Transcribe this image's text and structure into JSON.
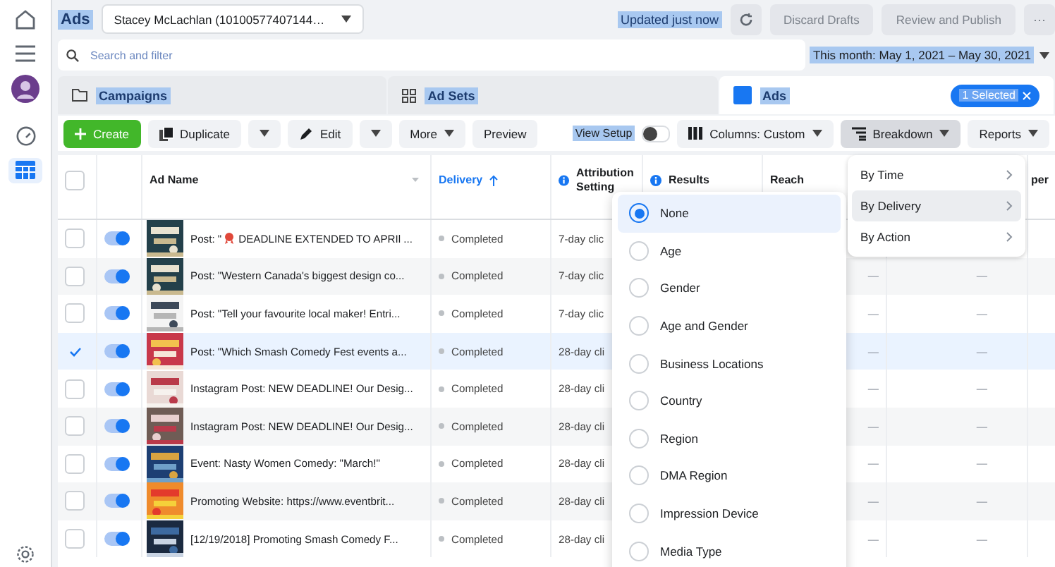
{
  "sidebar": {
    "items": [
      {
        "kind": "home",
        "selected": false
      },
      {
        "kind": "menu",
        "selected": false
      },
      {
        "kind": "avatar",
        "selected": false
      },
      {
        "kind": "gauge",
        "selected": false
      },
      {
        "kind": "table",
        "selected": true
      },
      {
        "kind": "gear",
        "selected": false
      }
    ]
  },
  "top_bar": {
    "title": "Ads",
    "account": "Stacey McLachlan (10100577407144…",
    "status": "Updated just now",
    "buttons": [
      {
        "label": "Discard Drafts",
        "disabled": true
      },
      {
        "label": "Review and Publish",
        "disabled": true
      }
    ],
    "more": "···"
  },
  "search": {
    "placeholder": "Search and filter"
  },
  "date_range": "This month: May 1, 2021 – May 30, 2021",
  "tabs": [
    {
      "kind": "campaigns",
      "label": "Campaigns",
      "selected": false
    },
    {
      "kind": "adsets",
      "label": "Ad Sets",
      "selected": false
    },
    {
      "kind": "ads",
      "label": "Ads",
      "selected": true,
      "badge": "1 Selected"
    }
  ],
  "toolbar": {
    "buttons": [
      {
        "kind": "create",
        "label": "Create"
      },
      {
        "kind": "duplicate",
        "label": "Duplicate"
      },
      {
        "kind": "edit",
        "label": "Edit"
      },
      {
        "kind": "more",
        "label": "More"
      },
      {
        "kind": "preview",
        "label": "Preview"
      }
    ],
    "view_setup": {
      "label": "View Setup",
      "on": false
    },
    "right_buttons": [
      {
        "kind": "columns",
        "label": "Columns: Custom",
        "pressed": false
      },
      {
        "kind": "breakdown",
        "label": "Breakdown",
        "pressed": true
      },
      {
        "kind": "reports",
        "label": "Reports",
        "pressed": false
      }
    ]
  },
  "table": {
    "select_all": {
      "checked": false
    },
    "columns": [
      {
        "label": "Ad Name",
        "sorted": false,
        "info": false
      },
      {
        "label": "Delivery",
        "sorted": true,
        "info": false
      },
      {
        "label": "Attribution Setting",
        "sorted": false,
        "info": true
      },
      {
        "label": "Results",
        "sorted": false,
        "info": true
      },
      {
        "label": "Reach",
        "sorted": false,
        "info": false
      },
      {
        "label": "per",
        "sorted": false,
        "info": false
      }
    ],
    "rows": [
      {
        "checked": false,
        "on": true,
        "name": "Post: \"",
        "name_after_icon": "DEADLINE EXTENDED TO APRIl ...",
        "delivery": "Completed",
        "attribution": "7-day clic"
      },
      {
        "checked": false,
        "on": true,
        "name": "Post: \"Western Canada's biggest design co...",
        "delivery": "Completed",
        "attribution": "7-day clic",
        "reach": "—",
        "column_7": "—"
      },
      {
        "checked": false,
        "on": true,
        "name": "Post: \"Tell your favourite local maker! Entri...",
        "delivery": "Completed",
        "attribution": "7-day clic",
        "reach": "—",
        "column_7": "—"
      },
      {
        "checked": true,
        "on": true,
        "name": "Post: \"Which Smash Comedy Fest events a...",
        "delivery": "Completed",
        "attribution": "28-day cli",
        "reach": "—",
        "column_7": "—"
      },
      {
        "checked": false,
        "on": true,
        "name": "Instagram Post: NEW DEADLINE! Our Desig...",
        "delivery": "Completed",
        "attribution": "28-day cli",
        "reach": "—",
        "column_7": "—"
      },
      {
        "checked": false,
        "on": true,
        "name": "Instagram Post: NEW DEADLINE! Our Desig...",
        "delivery": "Completed",
        "attribution": "28-day cli",
        "reach": "—",
        "column_7": "—"
      },
      {
        "checked": false,
        "on": true,
        "name": "Event: Nasty Women Comedy: \"March!\"",
        "delivery": "Completed",
        "attribution": "28-day cli",
        "reach": "—",
        "column_7": "—"
      },
      {
        "checked": false,
        "on": true,
        "name": "Promoting Website: https://www.eventbrit...",
        "delivery": "Completed",
        "attribution": "28-day cli",
        "reach": "—",
        "column_7": "—"
      },
      {
        "checked": false,
        "on": true,
        "name": "[12/19/2018] Promoting Smash Comedy F...",
        "delivery": "Completed",
        "attribution": "28-day cli",
        "reach": "—",
        "column_7": "—"
      }
    ]
  },
  "breakdown_menu": {
    "options": [
      {
        "label": "None",
        "selected": true
      },
      {
        "label": "Age",
        "selected": false
      },
      {
        "label": "Gender",
        "selected": false
      },
      {
        "label": "Age and Gender",
        "selected": false
      },
      {
        "label": "Business Locations",
        "selected": false
      },
      {
        "label": "Country",
        "selected": false
      },
      {
        "label": "Region",
        "selected": false
      },
      {
        "label": "DMA Region",
        "selected": false
      },
      {
        "label": "Impression Device",
        "selected": false
      },
      {
        "label": "Media Type",
        "selected": false
      }
    ]
  },
  "breakdown_submenu": {
    "items": [
      {
        "label": "By Time",
        "selected": false
      },
      {
        "label": "By Delivery",
        "selected": true
      },
      {
        "label": "By Action",
        "selected": false
      }
    ]
  }
}
